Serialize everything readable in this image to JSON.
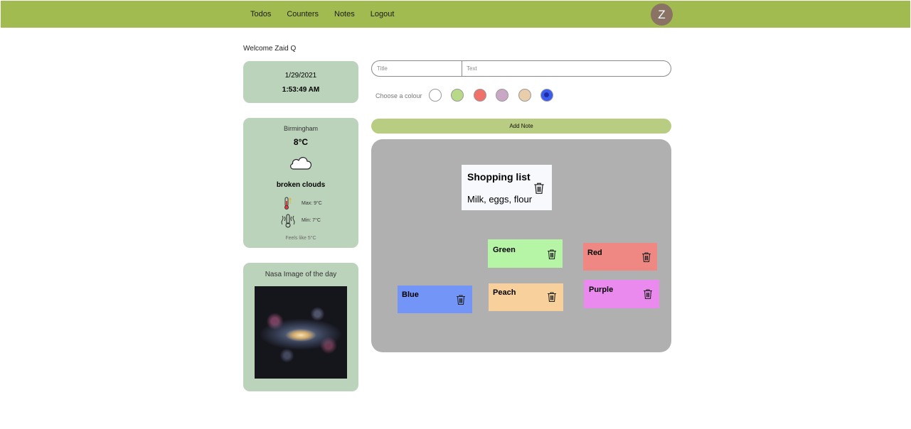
{
  "nav": {
    "links": [
      "Todos",
      "Counters",
      "Notes",
      "Logout"
    ],
    "avatar_initial": "Z"
  },
  "welcome": "Welcome Zaid Q",
  "clock": {
    "date": "1/29/2021",
    "time": "1:53:49 AM"
  },
  "weather": {
    "city": "Birmingham",
    "temp": "8°C",
    "icon": "cloud-icon",
    "description": "broken clouds",
    "max": "Max: 9°C",
    "min": "Min: 7°C",
    "feels_like": "Feels like 5°C"
  },
  "nasa": {
    "title": "Nasa Image of the day"
  },
  "form": {
    "title_placeholder": "Title",
    "text_placeholder": "Text",
    "colour_label": "Choose a colour",
    "swatches": [
      "#ffffff",
      "#b8d987",
      "#f0706a",
      "#c9a8c6",
      "#e8ceab",
      "#3a5cf0"
    ],
    "selected_swatch": 5,
    "add_label": "Add Note"
  },
  "notes": [
    {
      "title": "Shopping list",
      "body": "Milk, eggs, flour",
      "color": "#f7f9fd"
    },
    {
      "title": "Green",
      "color": "#b6f4a6"
    },
    {
      "title": "Red",
      "color": "#ef8883"
    },
    {
      "title": "Blue",
      "color": "#7395f8"
    },
    {
      "title": "Peach",
      "color": "#f8d09c"
    },
    {
      "title": "Purple",
      "color": "#eb8aee"
    }
  ]
}
